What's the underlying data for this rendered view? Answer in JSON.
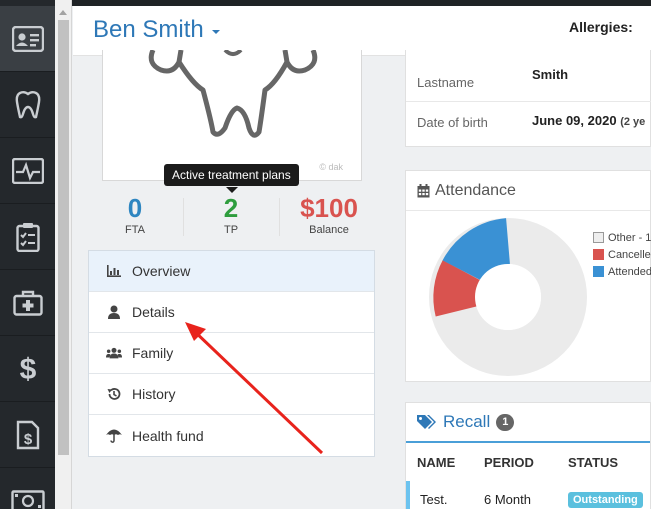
{
  "header": {
    "patient_name": "Ben Smith",
    "allergies_label": "Allergies:"
  },
  "sidebar": {
    "items": [
      {
        "icon": "id-card-icon",
        "active": true
      },
      {
        "icon": "tooth-icon"
      },
      {
        "icon": "heart-monitor-icon"
      },
      {
        "icon": "clipboard-icon"
      },
      {
        "icon": "medical-kit-icon"
      },
      {
        "icon": "dollar-icon"
      },
      {
        "icon": "invoice-icon"
      },
      {
        "icon": "money-icon"
      }
    ]
  },
  "tooth_card": {
    "watermark": "© dak"
  },
  "tooltip": {
    "text": "Active treatment plans"
  },
  "stats": [
    {
      "value": "0",
      "label": "FTA",
      "color": "#2e86c1"
    },
    {
      "value": "2",
      "label": "TP",
      "color": "#2e9d3e"
    },
    {
      "value": "$100",
      "label": "Balance",
      "color": "#d9534f"
    }
  ],
  "menu": {
    "items": [
      {
        "label": "Overview",
        "icon": "bar-chart-icon",
        "active": true
      },
      {
        "label": "Details",
        "icon": "user-icon"
      },
      {
        "label": "Family",
        "icon": "users-icon"
      },
      {
        "label": "History",
        "icon": "history-icon"
      },
      {
        "label": "Health fund",
        "icon": "umbrella-icon"
      }
    ]
  },
  "details": {
    "lastname_label": "Lastname",
    "lastname_value": "Smith",
    "dob_label": "Date of birth",
    "dob_value": "June 09, 2020",
    "dob_suffix": "(2 ye"
  },
  "attendance": {
    "title": "Attendance",
    "legend": [
      {
        "label": "Other - 1",
        "color": "#eeeeee"
      },
      {
        "label": "Cancelle",
        "color": "#d9534f"
      },
      {
        "label": "Attended",
        "color": "#3a91d4"
      }
    ]
  },
  "recall": {
    "title": "Recall",
    "count": "1",
    "columns": [
      "NAME",
      "PERIOD",
      "STATUS"
    ],
    "rows": [
      {
        "name": "Test.",
        "period": "6 Month",
        "status": "Outstanding"
      }
    ]
  },
  "colors": {
    "accent": "#2e78b7",
    "sidebar_bg": "#24282c",
    "annotation_arrow": "#e8231c"
  }
}
